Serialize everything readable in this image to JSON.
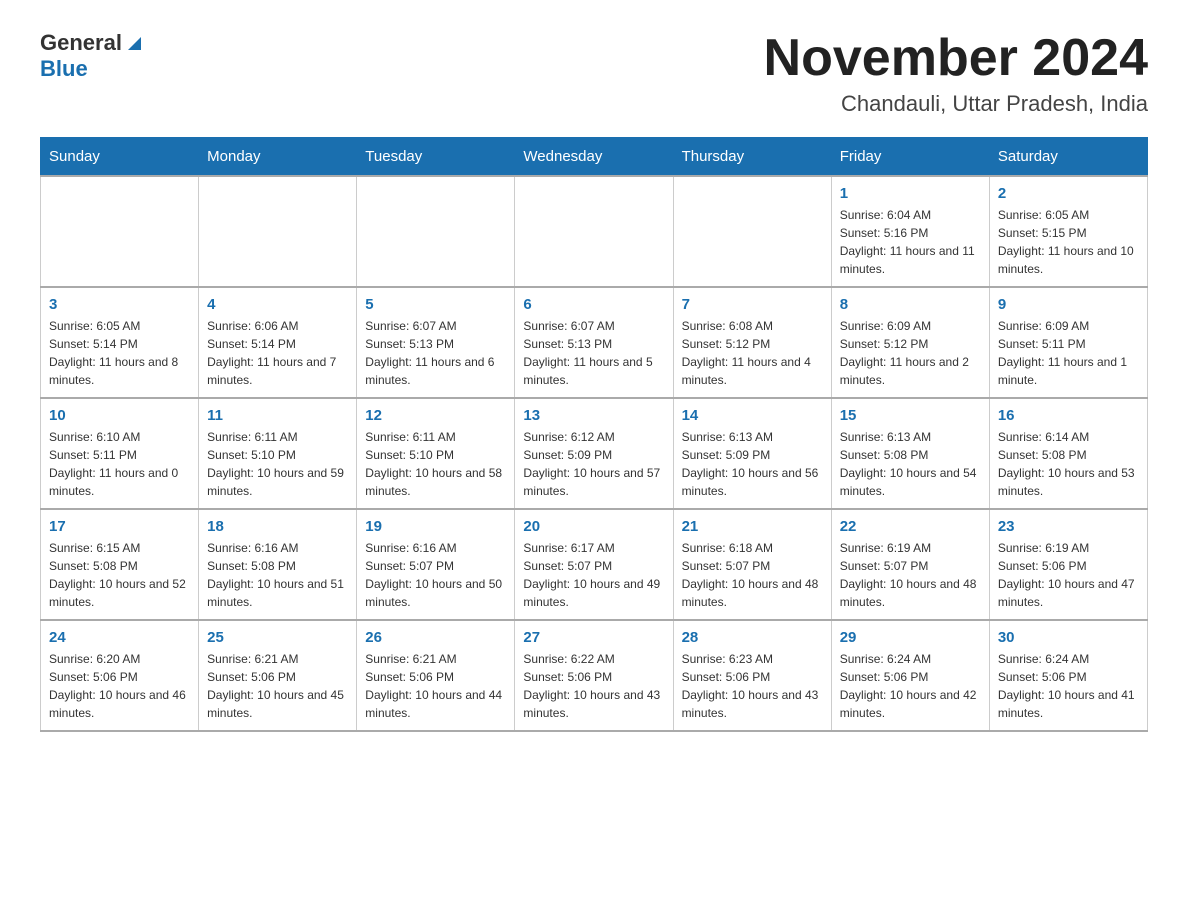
{
  "header": {
    "logo_general": "General",
    "logo_blue": "Blue",
    "month_year": "November 2024",
    "location": "Chandauli, Uttar Pradesh, India"
  },
  "weekdays": [
    "Sunday",
    "Monday",
    "Tuesday",
    "Wednesday",
    "Thursday",
    "Friday",
    "Saturday"
  ],
  "weeks": [
    [
      {
        "day": "",
        "info": ""
      },
      {
        "day": "",
        "info": ""
      },
      {
        "day": "",
        "info": ""
      },
      {
        "day": "",
        "info": ""
      },
      {
        "day": "",
        "info": ""
      },
      {
        "day": "1",
        "info": "Sunrise: 6:04 AM\nSunset: 5:16 PM\nDaylight: 11 hours and 11 minutes."
      },
      {
        "day": "2",
        "info": "Sunrise: 6:05 AM\nSunset: 5:15 PM\nDaylight: 11 hours and 10 minutes."
      }
    ],
    [
      {
        "day": "3",
        "info": "Sunrise: 6:05 AM\nSunset: 5:14 PM\nDaylight: 11 hours and 8 minutes."
      },
      {
        "day": "4",
        "info": "Sunrise: 6:06 AM\nSunset: 5:14 PM\nDaylight: 11 hours and 7 minutes."
      },
      {
        "day": "5",
        "info": "Sunrise: 6:07 AM\nSunset: 5:13 PM\nDaylight: 11 hours and 6 minutes."
      },
      {
        "day": "6",
        "info": "Sunrise: 6:07 AM\nSunset: 5:13 PM\nDaylight: 11 hours and 5 minutes."
      },
      {
        "day": "7",
        "info": "Sunrise: 6:08 AM\nSunset: 5:12 PM\nDaylight: 11 hours and 4 minutes."
      },
      {
        "day": "8",
        "info": "Sunrise: 6:09 AM\nSunset: 5:12 PM\nDaylight: 11 hours and 2 minutes."
      },
      {
        "day": "9",
        "info": "Sunrise: 6:09 AM\nSunset: 5:11 PM\nDaylight: 11 hours and 1 minute."
      }
    ],
    [
      {
        "day": "10",
        "info": "Sunrise: 6:10 AM\nSunset: 5:11 PM\nDaylight: 11 hours and 0 minutes."
      },
      {
        "day": "11",
        "info": "Sunrise: 6:11 AM\nSunset: 5:10 PM\nDaylight: 10 hours and 59 minutes."
      },
      {
        "day": "12",
        "info": "Sunrise: 6:11 AM\nSunset: 5:10 PM\nDaylight: 10 hours and 58 minutes."
      },
      {
        "day": "13",
        "info": "Sunrise: 6:12 AM\nSunset: 5:09 PM\nDaylight: 10 hours and 57 minutes."
      },
      {
        "day": "14",
        "info": "Sunrise: 6:13 AM\nSunset: 5:09 PM\nDaylight: 10 hours and 56 minutes."
      },
      {
        "day": "15",
        "info": "Sunrise: 6:13 AM\nSunset: 5:08 PM\nDaylight: 10 hours and 54 minutes."
      },
      {
        "day": "16",
        "info": "Sunrise: 6:14 AM\nSunset: 5:08 PM\nDaylight: 10 hours and 53 minutes."
      }
    ],
    [
      {
        "day": "17",
        "info": "Sunrise: 6:15 AM\nSunset: 5:08 PM\nDaylight: 10 hours and 52 minutes."
      },
      {
        "day": "18",
        "info": "Sunrise: 6:16 AM\nSunset: 5:08 PM\nDaylight: 10 hours and 51 minutes."
      },
      {
        "day": "19",
        "info": "Sunrise: 6:16 AM\nSunset: 5:07 PM\nDaylight: 10 hours and 50 minutes."
      },
      {
        "day": "20",
        "info": "Sunrise: 6:17 AM\nSunset: 5:07 PM\nDaylight: 10 hours and 49 minutes."
      },
      {
        "day": "21",
        "info": "Sunrise: 6:18 AM\nSunset: 5:07 PM\nDaylight: 10 hours and 48 minutes."
      },
      {
        "day": "22",
        "info": "Sunrise: 6:19 AM\nSunset: 5:07 PM\nDaylight: 10 hours and 48 minutes."
      },
      {
        "day": "23",
        "info": "Sunrise: 6:19 AM\nSunset: 5:06 PM\nDaylight: 10 hours and 47 minutes."
      }
    ],
    [
      {
        "day": "24",
        "info": "Sunrise: 6:20 AM\nSunset: 5:06 PM\nDaylight: 10 hours and 46 minutes."
      },
      {
        "day": "25",
        "info": "Sunrise: 6:21 AM\nSunset: 5:06 PM\nDaylight: 10 hours and 45 minutes."
      },
      {
        "day": "26",
        "info": "Sunrise: 6:21 AM\nSunset: 5:06 PM\nDaylight: 10 hours and 44 minutes."
      },
      {
        "day": "27",
        "info": "Sunrise: 6:22 AM\nSunset: 5:06 PM\nDaylight: 10 hours and 43 minutes."
      },
      {
        "day": "28",
        "info": "Sunrise: 6:23 AM\nSunset: 5:06 PM\nDaylight: 10 hours and 43 minutes."
      },
      {
        "day": "29",
        "info": "Sunrise: 6:24 AM\nSunset: 5:06 PM\nDaylight: 10 hours and 42 minutes."
      },
      {
        "day": "30",
        "info": "Sunrise: 6:24 AM\nSunset: 5:06 PM\nDaylight: 10 hours and 41 minutes."
      }
    ]
  ]
}
